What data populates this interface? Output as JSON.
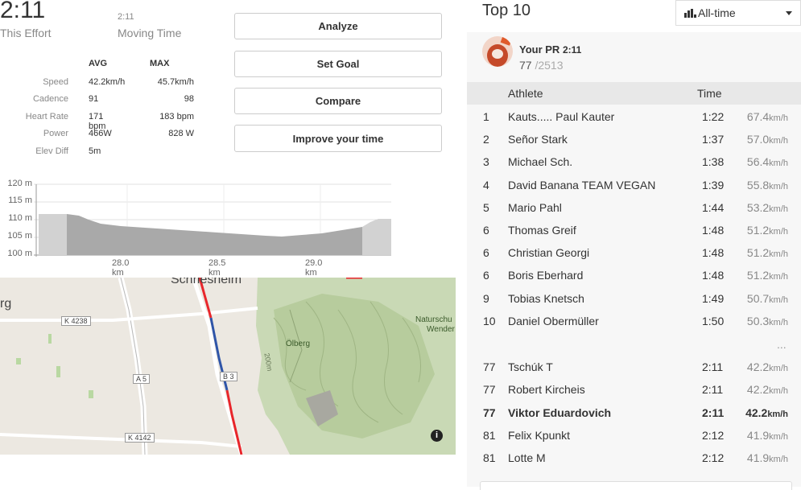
{
  "effort": {
    "time": "2:11",
    "time_label": "This Effort",
    "moving_value": "2:11",
    "moving_label": "Moving Time"
  },
  "stats": {
    "headers": {
      "avg": "AVG",
      "max": "MAX"
    },
    "rows": [
      {
        "label": "Speed",
        "avg": "42.2km/h",
        "max": "45.7km/h"
      },
      {
        "label": "Cadence",
        "avg": "91",
        "max": "98"
      },
      {
        "label": "Heart Rate",
        "avg": "171 bpm",
        "max": "183 bpm"
      },
      {
        "label": "Power",
        "avg": "466W",
        "max": "828 W"
      },
      {
        "label": "Elev Diff",
        "avg": "5m",
        "max": ""
      }
    ]
  },
  "buttons": {
    "analyze": "Analyze",
    "set_goal": "Set Goal",
    "compare": "Compare",
    "improve": "Improve your time"
  },
  "elevation_chart": {
    "y_ticks": [
      "120 m",
      "115 m",
      "110 m",
      "105 m",
      "100 m"
    ],
    "x_ticks": [
      "28.0 km",
      "28.5 km",
      "29.0 km"
    ]
  },
  "map": {
    "labels": {
      "town": "Schriesheim",
      "town_partial": "rg",
      "k4238": "K 4238",
      "a5": "A 5",
      "b3": "B 3",
      "k4142": "K 4142",
      "olberg": "Ölberg",
      "natur": "Naturschu",
      "wender": "Wender",
      "contour": "200m"
    },
    "info_icon": "info-icon"
  },
  "leaderboard": {
    "title": "Top 10",
    "filter": "All-time",
    "pr_label": "Your PR",
    "pr_time": "2:11",
    "pr_rank": "77",
    "pr_total": "/2513",
    "col_athlete": "Athlete",
    "col_time": "Time",
    "ellipsis": "...",
    "speed_unit": "km/h",
    "rows": [
      {
        "rank": "1",
        "name": "Kauts..... Paul Kauter",
        "time": "1:22",
        "speed": "67.4"
      },
      {
        "rank": "2",
        "name": "Señor Stark",
        "time": "1:37",
        "speed": "57.0"
      },
      {
        "rank": "3",
        "name": "Michael Sch.",
        "time": "1:38",
        "speed": "56.4"
      },
      {
        "rank": "4",
        "name": "David Banana TEAM VEGAN",
        "time": "1:39",
        "speed": "55.8"
      },
      {
        "rank": "5",
        "name": "Mario Pahl",
        "time": "1:44",
        "speed": "53.2"
      },
      {
        "rank": "6",
        "name": "Thomas Greif",
        "time": "1:48",
        "speed": "51.2"
      },
      {
        "rank": "6",
        "name": "Christian Georgi",
        "time": "1:48",
        "speed": "51.2"
      },
      {
        "rank": "6",
        "name": "Boris Eberhard",
        "time": "1:48",
        "speed": "51.2"
      },
      {
        "rank": "9",
        "name": "Tobias Knetsch",
        "time": "1:49",
        "speed": "50.7"
      },
      {
        "rank": "10",
        "name": "Daniel Obermüller",
        "time": "1:50",
        "speed": "50.3"
      }
    ],
    "nearby": [
      {
        "rank": "77",
        "name": "Tschúk T",
        "time": "2:11",
        "speed": "42.2",
        "me": false
      },
      {
        "rank": "77",
        "name": "Robert Kircheis",
        "time": "2:11",
        "speed": "42.2",
        "me": false
      },
      {
        "rank": "77",
        "name": "Viktor Eduardovich",
        "time": "2:11",
        "speed": "42.2",
        "me": true
      },
      {
        "rank": "81",
        "name": "Felix Kpunkt",
        "time": "2:12",
        "speed": "41.9",
        "me": false
      },
      {
        "rank": "81",
        "name": "Lotte M",
        "time": "2:12",
        "speed": "41.9",
        "me": false
      }
    ]
  },
  "colors": {
    "route_red": "#e8262b",
    "route_blue": "#2f55a8",
    "accent_avatar": "#e05a2b"
  }
}
